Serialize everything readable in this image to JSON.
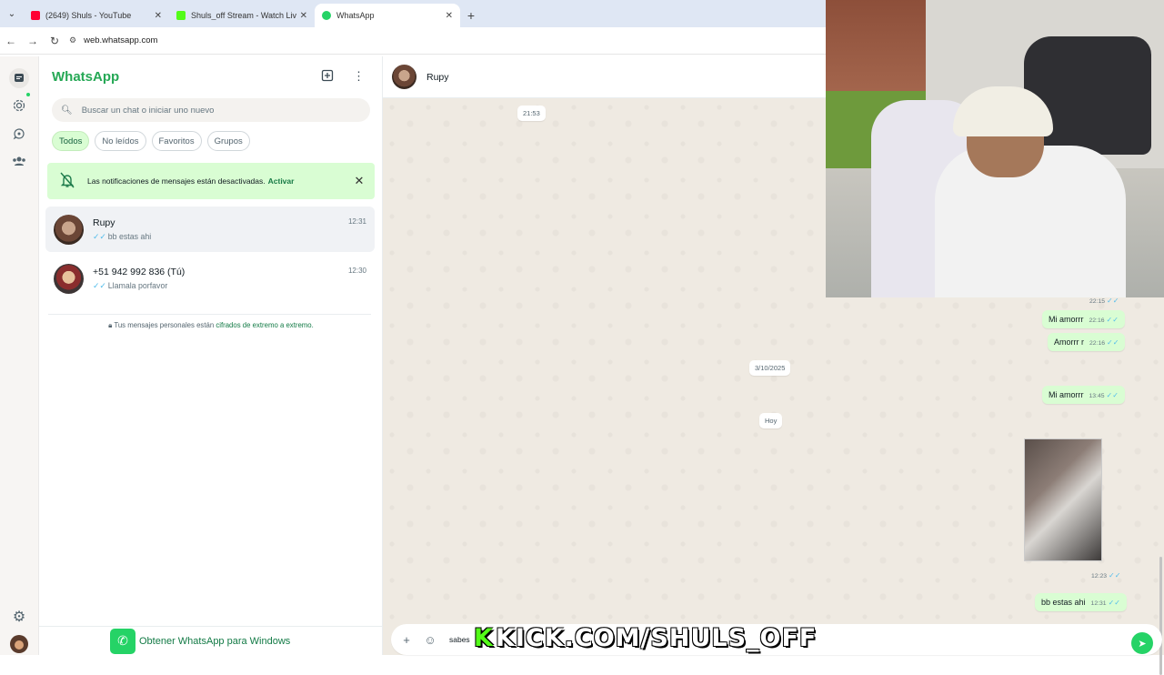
{
  "browser": {
    "tabs": [
      {
        "title": "(2649) Shuls - YouTube",
        "favicon_color": "#ff0033"
      },
      {
        "title": "Shuls_off Stream - Watch Live o",
        "favicon_color": "#53fc18"
      },
      {
        "title": "WhatsApp",
        "favicon_color": "#25d366"
      }
    ],
    "url": "web.whatsapp.com"
  },
  "sidebar": {
    "title": "WhatsApp",
    "search_placeholder": "Buscar un chat o iniciar uno nuevo",
    "filters": [
      "Todos",
      "No leídos",
      "Favoritos",
      "Grupos"
    ],
    "notification": {
      "text": "Las notificaciones de mensajes están desactivadas.",
      "action": "Activar"
    },
    "chats": [
      {
        "name": "Rupy",
        "last": "bb estas ahi",
        "time": "12:31"
      },
      {
        "name": "+51 942 992 836 (Tú)",
        "last": "Llamala porfavor",
        "time": "12:30"
      }
    ],
    "encryption": {
      "prefix": "Tus mensajes personales están ",
      "link": "cifrados de extremo a extremo."
    },
    "get_app": "Obtener WhatsApp para Windows"
  },
  "conversation": {
    "contact": "Rupy",
    "top_time": "21:53",
    "partial_time": "22:15",
    "messages": [
      {
        "text": "Mi amorrr",
        "time": "22:16"
      },
      {
        "text": "Amorrr r",
        "time": "22:16"
      },
      {
        "text": "Mi amorrr",
        "time": "13:45"
      },
      {
        "text": "bb estas ahi",
        "time": "12:31"
      }
    ],
    "date_separators": [
      "3/10/2025",
      "Hoy"
    ],
    "photo_time": "12:23",
    "draft": "sabes"
  },
  "overlay": {
    "kick_k": "K",
    "kick_text": "KICK.COM/SHULS_OFF"
  },
  "colors": {
    "accent": "#25d366",
    "brand_text": "#25a855",
    "bubble_out": "#d9fdd3",
    "check_read": "#53bdeb"
  }
}
